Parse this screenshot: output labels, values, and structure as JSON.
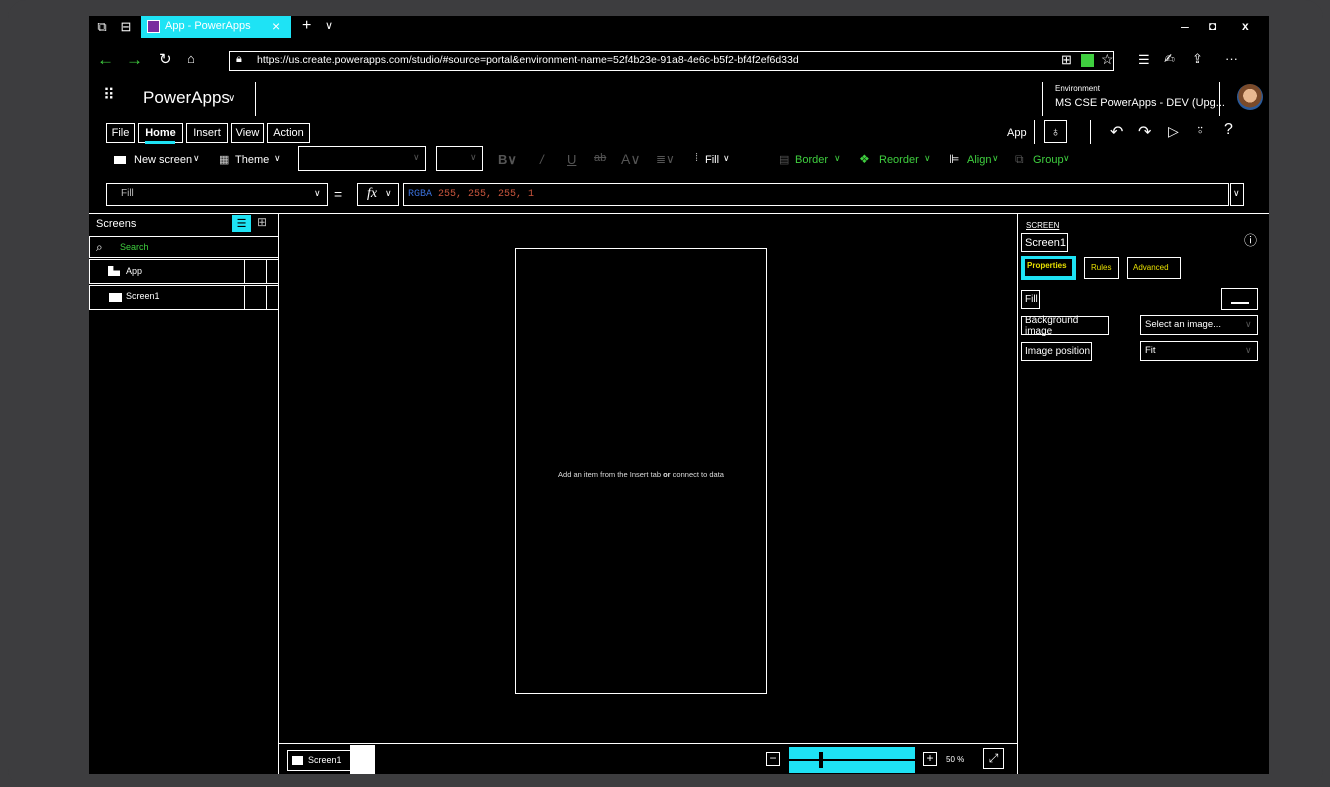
{
  "browser": {
    "tab_title": "App - PowerApps",
    "url": "https://us.create.powerapps.com/studio/#source=portal&environment-name=52f4b23e-91a8-4e6c-b5f2-bf4f2ef6d33d",
    "close_tab": "×",
    "new_tab": "+",
    "tab_menu": "∨"
  },
  "app": {
    "brand": "PowerApps",
    "brand_chevron": "∨",
    "environment_label": "Environment",
    "environment_name": "MS CSE PowerApps - DEV (Upg..."
  },
  "ribbon": {
    "tabs": [
      "File",
      "Home",
      "Insert",
      "View",
      "Action"
    ],
    "active_tab": "Home",
    "app_label": "App",
    "new_screen": "New screen",
    "theme": "Theme",
    "fill": "Fill",
    "border": "Border",
    "reorder": "Reorder",
    "align": "Align",
    "group": "Group"
  },
  "formula_bar": {
    "property": "Fill",
    "equals": "=",
    "fx": "fx",
    "func": "RGBA",
    "args": "255, 255, 255, 1"
  },
  "screens_panel": {
    "title": "Screens",
    "search_placeholder": "Search",
    "items": [
      "App",
      "Screen1"
    ]
  },
  "canvas": {
    "hint_prefix": "Add an item from the Insert tab ",
    "hint_or": "or",
    "hint_suffix": " connect to data"
  },
  "bottom_bar": {
    "screen_chip": "Screen1",
    "zoom": "50 %",
    "zoom_fraction": 0.5
  },
  "properties_panel": {
    "section": "SCREEN",
    "screen_name": "Screen1",
    "tabs": [
      "Properties",
      "Rules",
      "Advanced"
    ],
    "fill_label": "Fill",
    "background_image_label": "Background image",
    "background_image_value": "Select an image...",
    "image_position_label": "Image position",
    "image_position_value": "Fit"
  },
  "colors": {
    "accent": "#1ee3f5",
    "green": "#3fcf3f",
    "formula_func": "#3a6fd8",
    "formula_args": "#c8553d"
  }
}
